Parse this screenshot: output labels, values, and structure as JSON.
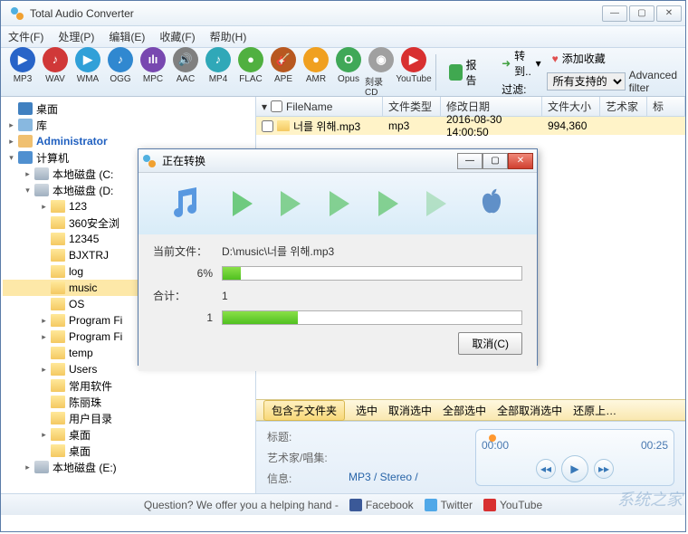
{
  "app": {
    "title": "Total Audio Converter"
  },
  "menu": {
    "file": "文件(F)",
    "process": "处理(P)",
    "edit": "编辑(E)",
    "favorites": "收藏(F)",
    "help": "帮助(H)"
  },
  "formats": [
    {
      "label": "MP3",
      "color": "#2864c8",
      "glyph": "▶"
    },
    {
      "label": "WAV",
      "color": "#d03838",
      "glyph": "♪"
    },
    {
      "label": "WMA",
      "color": "#30a0d8",
      "glyph": "▶"
    },
    {
      "label": "OGG",
      "color": "#3088d0",
      "glyph": "♪"
    },
    {
      "label": "MPC",
      "color": "#7848b0",
      "glyph": "ılı"
    },
    {
      "label": "AAC",
      "color": "#808080",
      "glyph": "🔊"
    },
    {
      "label": "MP4",
      "color": "#30a8b8",
      "glyph": "♪"
    },
    {
      "label": "FLAC",
      "color": "#50b040",
      "glyph": "●"
    },
    {
      "label": "APE",
      "color": "#b85820",
      "glyph": "🎸"
    },
    {
      "label": "AMR",
      "color": "#f0a020",
      "glyph": "●"
    },
    {
      "label": "Opus",
      "color": "#40a858",
      "glyph": "O"
    },
    {
      "label": "刻录 CD",
      "color": "#a0a0a0",
      "glyph": "◉"
    },
    {
      "label": "YouTube",
      "color": "#d83030",
      "glyph": "▶"
    }
  ],
  "toolbar": {
    "report": "报告",
    "convert": "转到..",
    "favorite": "添加收藏",
    "filter_label": "过滤:",
    "filter_value": "所有支持的",
    "advanced": "Advanced filter"
  },
  "tree": [
    {
      "depth": 0,
      "exp": "",
      "icon": "desktop",
      "label": "桌面"
    },
    {
      "depth": 0,
      "exp": "▸",
      "icon": "lib",
      "label": "库"
    },
    {
      "depth": 0,
      "exp": "▸",
      "icon": "user",
      "label": "Administrator",
      "color": "#2060c0",
      "bold": true
    },
    {
      "depth": 0,
      "exp": "▾",
      "icon": "pc",
      "label": "计算机"
    },
    {
      "depth": 1,
      "exp": "▸",
      "icon": "drive",
      "label": "本地磁盘 (C:"
    },
    {
      "depth": 1,
      "exp": "▾",
      "icon": "drive",
      "label": "本地磁盘 (D:"
    },
    {
      "depth": 2,
      "exp": "▸",
      "icon": "folder",
      "label": "123"
    },
    {
      "depth": 2,
      "exp": "",
      "icon": "folder",
      "label": "360安全浏"
    },
    {
      "depth": 2,
      "exp": "",
      "icon": "folder",
      "label": "12345"
    },
    {
      "depth": 2,
      "exp": "",
      "icon": "folder",
      "label": "BJXTRJ"
    },
    {
      "depth": 2,
      "exp": "",
      "icon": "folder",
      "label": "log"
    },
    {
      "depth": 2,
      "exp": "",
      "icon": "folder",
      "label": "music",
      "sel": true
    },
    {
      "depth": 2,
      "exp": "",
      "icon": "folder",
      "label": "OS"
    },
    {
      "depth": 2,
      "exp": "▸",
      "icon": "folder",
      "label": "Program Fi"
    },
    {
      "depth": 2,
      "exp": "▸",
      "icon": "folder",
      "label": "Program Fi"
    },
    {
      "depth": 2,
      "exp": "",
      "icon": "folder",
      "label": "temp"
    },
    {
      "depth": 2,
      "exp": "▸",
      "icon": "folder",
      "label": "Users"
    },
    {
      "depth": 2,
      "exp": "",
      "icon": "folder",
      "label": "常用软件"
    },
    {
      "depth": 2,
      "exp": "",
      "icon": "folder",
      "label": "陈丽珠"
    },
    {
      "depth": 2,
      "exp": "",
      "icon": "folder",
      "label": "用户目录"
    },
    {
      "depth": 2,
      "exp": "▸",
      "icon": "folder",
      "label": "桌面"
    },
    {
      "depth": 2,
      "exp": "",
      "icon": "folder",
      "label": "桌面"
    },
    {
      "depth": 1,
      "exp": "▸",
      "icon": "drive",
      "label": "本地磁盘 (E:)"
    }
  ],
  "cols": {
    "name": "FileName",
    "type": "文件类型",
    "date": "修改日期",
    "size": "文件大小",
    "artist": "艺术家",
    "title": "标"
  },
  "files": [
    {
      "name": "너를 위해.mp3",
      "type": "mp3",
      "date": "2016-08-30 14:00:50",
      "size": "994,360"
    }
  ],
  "selbar": {
    "incsub": "包含子文件夹",
    "sel": "选中",
    "unsel": "取消选中",
    "selall": "全部选中",
    "unselall": "全部取消选中",
    "revert": "还原上…"
  },
  "info": {
    "title_k": "标题:",
    "artist_k": "艺术家/唱集:",
    "info_k": "信息:",
    "info_v": "MP3 / Stereo /"
  },
  "player": {
    "t0": "00:00",
    "t1": "00:25"
  },
  "footer": {
    "q": "Question? We offer you a helping hand -",
    "fb": "Facebook",
    "tw": "Twitter",
    "yt": "YouTube"
  },
  "dialog": {
    "title": "正在转换",
    "curfile_k": "当前文件：",
    "curfile_v": "D:\\music\\너를 위해.mp3",
    "pct": "6%",
    "pct_val": 6,
    "total_k": "合计：",
    "total_v": "1",
    "done": "1",
    "done_pct": 25,
    "cancel": "取消(C)"
  },
  "watermark": "系统之家"
}
